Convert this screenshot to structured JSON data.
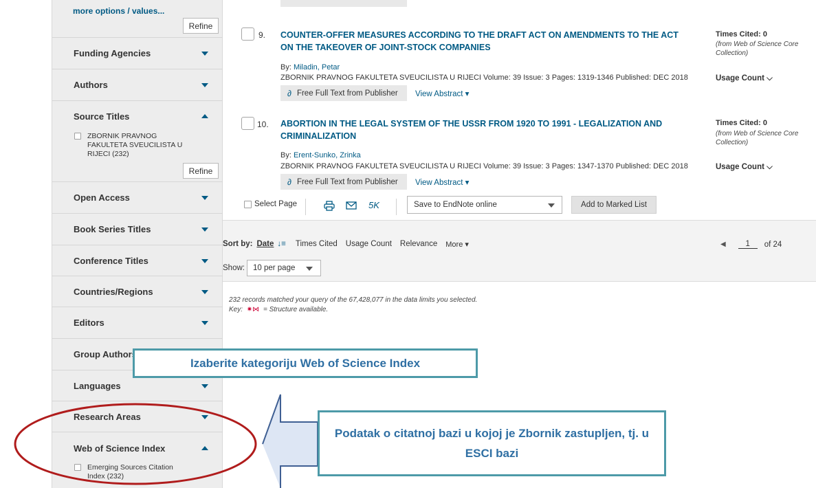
{
  "sidebar": {
    "more_options": "more options / values...",
    "refine_label": "Refine",
    "facets": {
      "funding": "Funding Agencies",
      "authors": "Authors",
      "source_titles": "Source Titles",
      "source_option": "ZBORNIK PRAVNOG FAKULTETA SVEUCILISTA U RIJECI (232)",
      "open_access": "Open Access",
      "book_series": "Book Series Titles",
      "conference": "Conference Titles",
      "countries": "Countries/Regions",
      "editors": "Editors",
      "group_authors": "Group Authors",
      "languages": "Languages",
      "research_areas": "Research Areas",
      "wos_index": "Web of Science Index",
      "wos_option": "Emerging Sources Citation Index (232)"
    }
  },
  "records": [
    {
      "num": "9.",
      "title": "COUNTER-OFFER MEASURES ACCORDING TO THE DRAFT ACT ON AMENDMENTS TO THE ACT ON THE TAKEOVER OF JOINT-STOCK COMPANIES",
      "by_label": "By: ",
      "author": "Miladin, Petar",
      "source": "ZBORNIK PRAVNOG FAKULTETA SVEUCILISTA U RIJECI  Volume: 39  Issue: 3  Pages: 1319-1346  Published: DEC 2018",
      "fulltext": "Free Full Text from Publisher",
      "abstract": "View Abstract ▾",
      "times_cited": "Times Cited: 0",
      "cited_from": "(from Web of Science Core Collection)",
      "usage": "Usage Count ⌵"
    },
    {
      "num": "10.",
      "title": "ABORTION IN THE LEGAL SYSTEM OF THE USSR FROM 1920 TO 1991 - LEGALIZATION AND CRIMINALIZATION",
      "by_label": "By: ",
      "author": "Erent-Sunko, Zrinka",
      "source": "ZBORNIK PRAVNOG FAKULTETA SVEUCILISTA U RIJECI  Volume: 39  Issue: 3  Pages: 1347-1370  Published: DEC 2018",
      "fulltext": "Free Full Text from Publisher",
      "abstract": "View Abstract ▾",
      "times_cited": "Times Cited: 0",
      "cited_from": "(from Web of Science Core Collection)",
      "usage": "Usage Count ⌵"
    }
  ],
  "actions": {
    "select_page": "Select Page",
    "count": "5K",
    "save_to": "Save to EndNote online",
    "add_marked": "Add to Marked List"
  },
  "sort": {
    "label": "Sort by:",
    "date": "Date",
    "times_cited": "Times Cited",
    "usage_count": "Usage Count",
    "relevance": "Relevance",
    "more": "More ▾"
  },
  "show": {
    "label": "Show:",
    "value": "10 per page"
  },
  "pager": {
    "page": "1",
    "of": "of 24"
  },
  "meta": {
    "matched": "232 records matched your query of the 67,428,077 in the data limits you selected.",
    "key": "Key:",
    "key_desc": "= Structure available."
  },
  "annotations": {
    "callout1": "Izaberite kategoriju Web of Science Index",
    "callout2": "Podatak o citatnoj bazi u kojoj je Zbornik zastupljen, tj. u ESCI bazi"
  },
  "colors": {
    "link": "#005a84",
    "annotation_border": "#4d9aa8",
    "annotation_text": "#2f6fa3",
    "ellipse": "#b01c1c",
    "arrow_fill": "#dde6f4",
    "arrow_stroke": "#3f5f93"
  }
}
